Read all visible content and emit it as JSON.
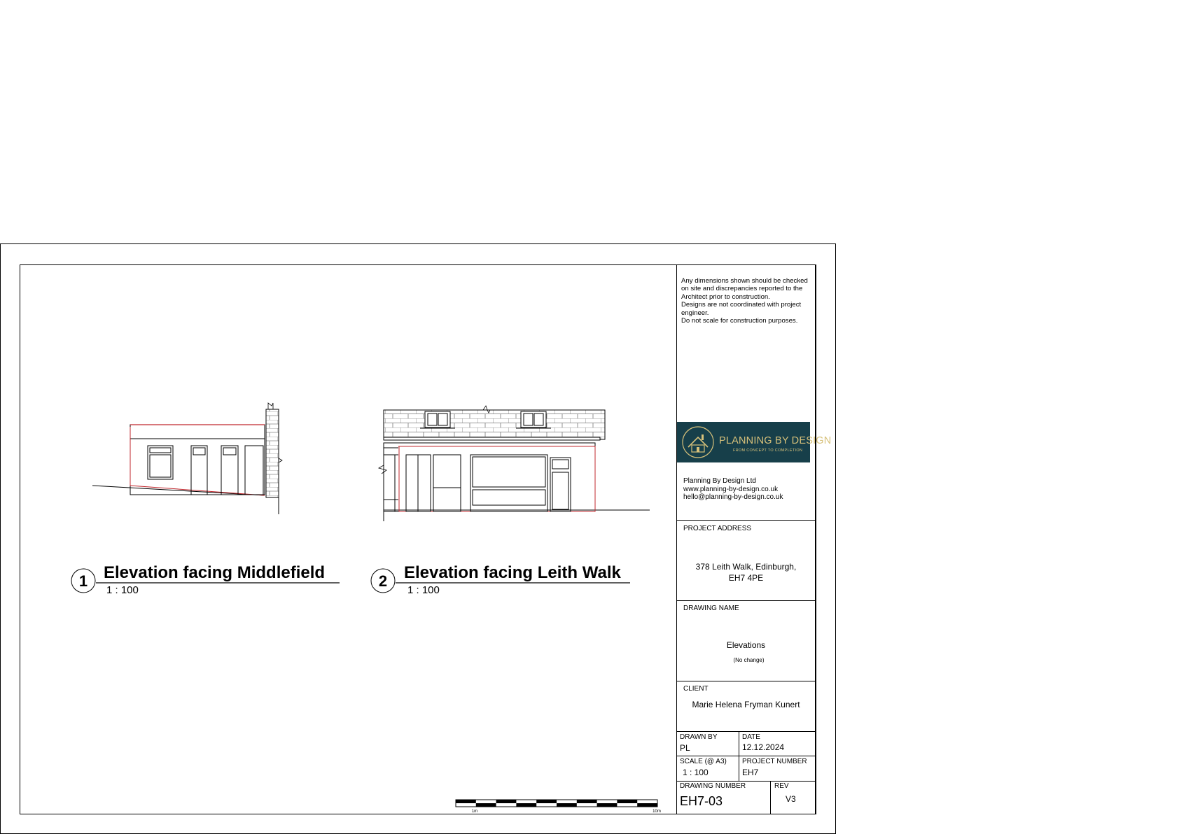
{
  "notes": [
    "Any dimensions shown should be checked",
    "on site and discrepancies reported to the",
    "Architect prior to construction.",
    "Designs are not coordinated with project",
    "engineer.",
    "Do not scale for construction purposes."
  ],
  "logo": {
    "name": "PLANNING BY DESIGN",
    "tagline": "FROM CONCEPT TO COMPLETION",
    "icon": "house-logo-icon",
    "background": "#173f4a",
    "accent": "#d7c17a"
  },
  "company": {
    "name": "Planning By Design Ltd",
    "website": "www.planning-by-design.co.uk",
    "email": "hello@planning-by-design.co.uk"
  },
  "project_address": {
    "label": "PROJECT ADDRESS",
    "line1": "378 Leith Walk, Edinburgh,",
    "line2": "EH7 4PE"
  },
  "drawing_name": {
    "label": "DRAWING NAME",
    "value": "Elevations",
    "note": "(No change)"
  },
  "client": {
    "label": "CLIENT",
    "value": "Marie Helena Fryman Kunert"
  },
  "drawn_by": {
    "label": "DRAWN BY",
    "value": "PL"
  },
  "date": {
    "label": "DATE",
    "value": "12.12.2024"
  },
  "scale": {
    "label": "SCALE (@ A3)",
    "value": "1 : 100"
  },
  "project_number": {
    "label": "PROJECT NUMBER",
    "value": "EH7"
  },
  "drawing_number": {
    "label": "DRAWING NUMBER",
    "value": "EH7-03"
  },
  "rev": {
    "label": "REV",
    "value": "V3"
  },
  "views": [
    {
      "number": "1",
      "title": "Elevation facing Middlefield",
      "scale": "1 : 100"
    },
    {
      "number": "2",
      "title": "Elevation facing Leith Walk",
      "scale": "1 : 100"
    }
  ],
  "scale_bar": {
    "start_label": "1m",
    "end_label": "10m"
  }
}
